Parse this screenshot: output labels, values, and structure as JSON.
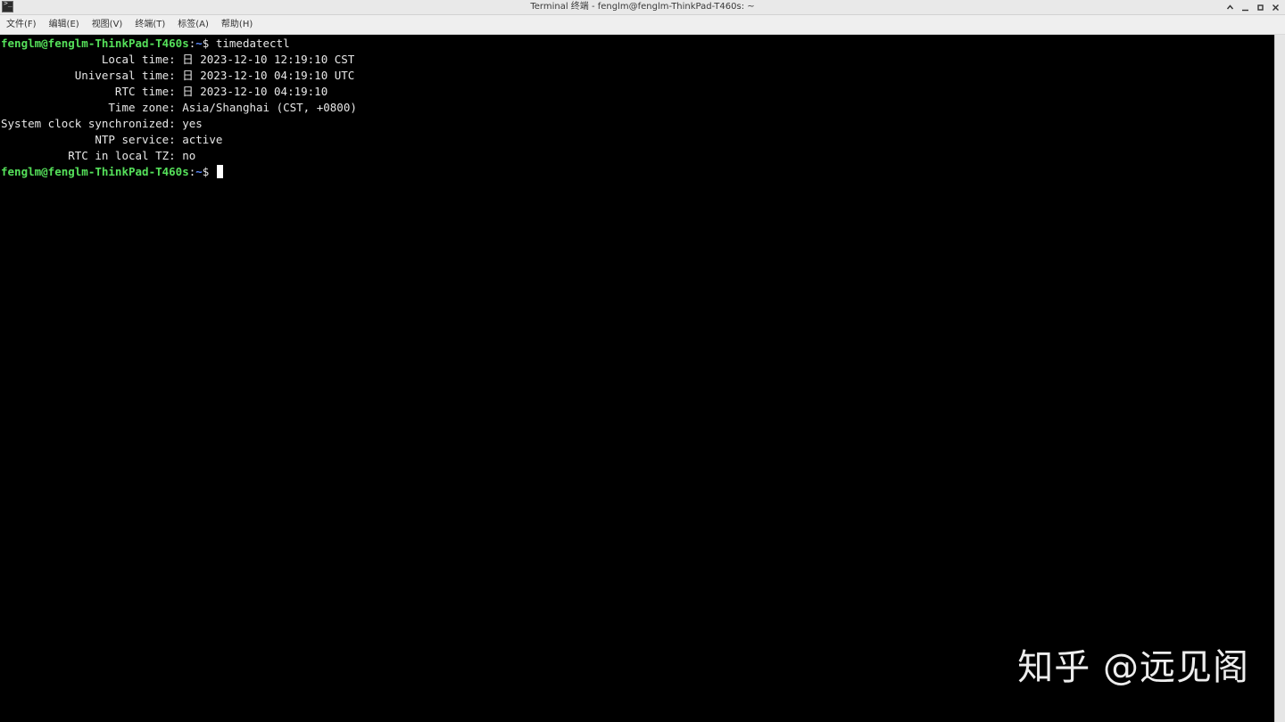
{
  "window": {
    "title": "Terminal 终端 - fenglm@fenglm-ThinkPad-T460s: ~",
    "app_icon": "terminal-icon",
    "controls": [
      "chevron-up-icon",
      "minimize-icon",
      "maximize-icon",
      "close-icon"
    ]
  },
  "menu": {
    "items": [
      {
        "label": "文件(F)"
      },
      {
        "label": "编辑(E)"
      },
      {
        "label": "视图(V)"
      },
      {
        "label": "终端(T)"
      },
      {
        "label": "标签(A)"
      },
      {
        "label": "帮助(H)"
      }
    ]
  },
  "terminal": {
    "prompt_user": "fenglm@fenglm-ThinkPad-T460s",
    "prompt_path": "~",
    "prompt_symbol": "$",
    "command": "timedatectl",
    "output": [
      {
        "key": "               Local time",
        "value": "日 2023-12-10 12:19:10 CST"
      },
      {
        "key": "           Universal time",
        "value": "日 2023-12-10 04:19:10 UTC"
      },
      {
        "key": "                 RTC time",
        "value": "日 2023-12-10 04:19:10"
      },
      {
        "key": "                Time zone",
        "value": "Asia/Shanghai (CST, +0800)"
      },
      {
        "key": "System clock synchronized",
        "value": "yes"
      },
      {
        "key": "              NTP service",
        "value": "active"
      },
      {
        "key": "          RTC in local TZ",
        "value": "no"
      }
    ]
  },
  "watermark": "知乎 @远见阁",
  "colors": {
    "prompt_user": "#55e05a",
    "prompt_path": "#5c8cff",
    "terminal_bg": "#000000",
    "terminal_fg": "#e8e8e8"
  }
}
